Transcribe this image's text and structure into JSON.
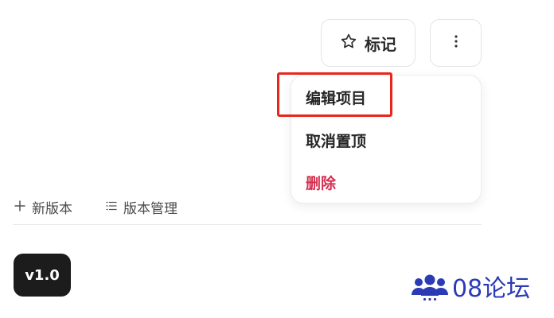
{
  "header": {
    "star_label": "标记",
    "icons": {
      "star": "star-icon",
      "more": "more-vertical-icon"
    }
  },
  "dropdown_menu": {
    "items": [
      {
        "label": "编辑项目",
        "highlighted": true
      },
      {
        "label": "取消置顶"
      },
      {
        "label": "删除",
        "danger": true
      }
    ],
    "danger_color": "#d53050",
    "highlight_color": "#e8261c"
  },
  "toolbar": {
    "new_version_label": "新版本",
    "manage_versions_label": "版本管理",
    "icons": {
      "new": "plus-icon",
      "manage": "list-icon"
    }
  },
  "version_badge": "v1.0",
  "watermark": {
    "text": "08论坛",
    "icon": "people-group-icon",
    "color": "#2b3bb6"
  }
}
